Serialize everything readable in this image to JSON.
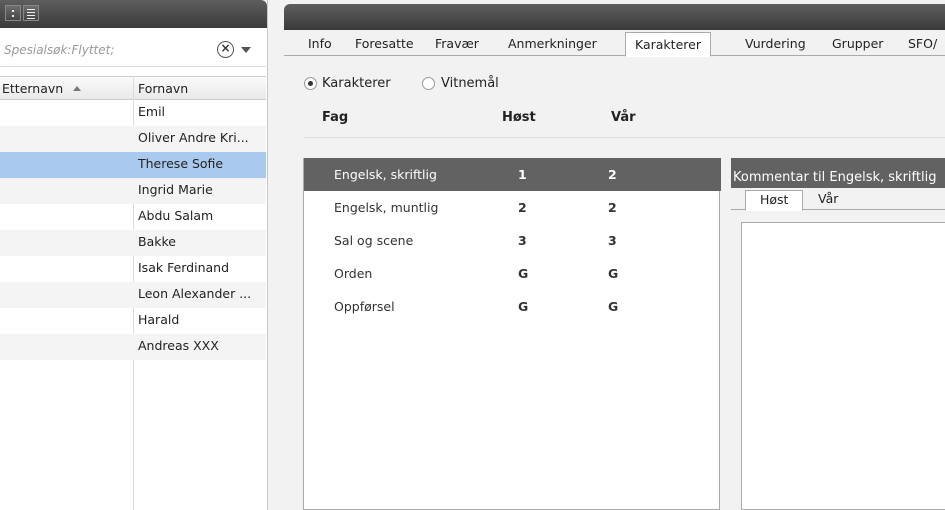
{
  "left_panel": {
    "toolbar": {
      "icons": [
        "menu-dots-icon",
        "list-icon"
      ]
    },
    "search": {
      "placeholder": "Spesialsøk:Flyttet;"
    },
    "columns": {
      "last_name": "Etternavn",
      "first_name": "Fornavn"
    },
    "rows": [
      {
        "first_name": "Emil"
      },
      {
        "first_name": "Oliver Andre Kri..."
      },
      {
        "first_name": "Therese Sofie",
        "selected": true
      },
      {
        "first_name": "Ingrid Marie"
      },
      {
        "first_name": "Abdu Salam"
      },
      {
        "first_name": "Bakke"
      },
      {
        "first_name": "Isak Ferdinand"
      },
      {
        "first_name": "Leon Alexander ..."
      },
      {
        "first_name": "Harald"
      },
      {
        "first_name": "Andreas XXX"
      }
    ]
  },
  "tabs": [
    "Info",
    "Foresatte",
    "Fravær",
    "Anmerkninger",
    "Karakterer",
    "Vurdering",
    "Grupper",
    "SFO/"
  ],
  "active_tab": "Karakterer",
  "radio": {
    "karakterer": "Karakterer",
    "vitnemal": "Vitnemål",
    "selected": "Karakterer"
  },
  "grades_table": {
    "headers": {
      "subject": "Fag",
      "autumn": "Høst",
      "spring": "Vår"
    },
    "rows": [
      {
        "subject": "Engelsk, skriftlig",
        "autumn": "1",
        "spring": "2",
        "selected": true
      },
      {
        "subject": "Engelsk, muntlig",
        "autumn": "2",
        "spring": "2"
      },
      {
        "subject": "Sal og scene",
        "autumn": "3",
        "spring": "3"
      },
      {
        "subject": "Orden",
        "autumn": "G",
        "spring": "G"
      },
      {
        "subject": "Oppførsel",
        "autumn": "G",
        "spring": "G"
      }
    ]
  },
  "comment": {
    "title": "Kommentar til Engelsk, skriftlig",
    "tabs": [
      "Høst",
      "Vår"
    ],
    "active_tab": "Høst"
  }
}
